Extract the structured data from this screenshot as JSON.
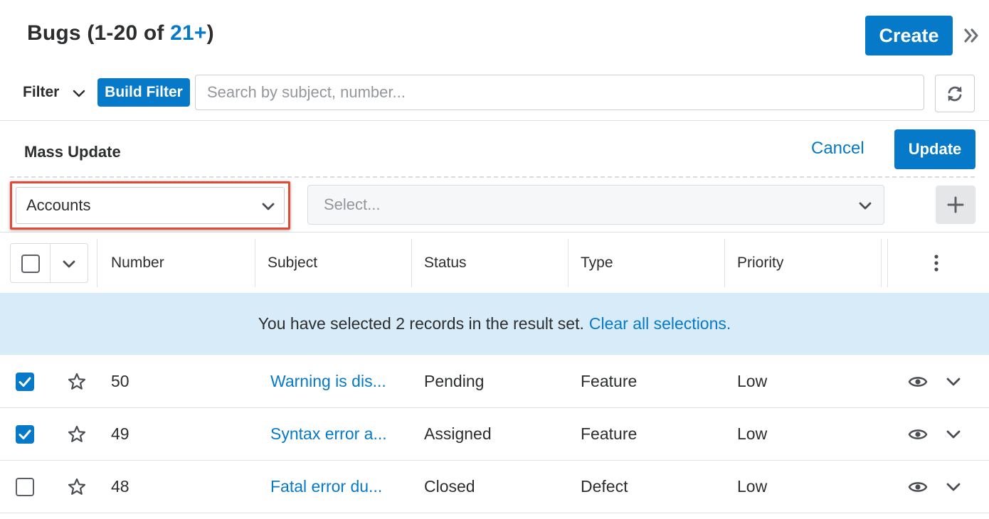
{
  "header": {
    "title_prefix": "Bugs (1-20 of ",
    "title_count": "21+",
    "title_suffix": ")",
    "create_label": "Create",
    "collapse_icon": "double-chevron-right-icon"
  },
  "filter": {
    "label": "Filter",
    "build_filter_label": "Build Filter",
    "search_placeholder": "Search by subject, number...",
    "refresh_icon": "refresh-icon"
  },
  "mass_update": {
    "title": "Mass Update",
    "cancel_label": "Cancel",
    "update_label": "Update",
    "field_select_value": "Accounts",
    "value_select_placeholder": "Select...",
    "add_icon": "plus-icon"
  },
  "table": {
    "columns": [
      "Number",
      "Subject",
      "Status",
      "Type",
      "Priority"
    ],
    "banner_text": "You have selected 2 records in the result set.",
    "banner_link": "Clear all selections.",
    "rows": [
      {
        "checked": true,
        "number": "50",
        "subject": "Warning is dis...",
        "status": "Pending",
        "type": "Feature",
        "priority": "Low"
      },
      {
        "checked": true,
        "number": "49",
        "subject": "Syntax error a...",
        "status": "Assigned",
        "type": "Feature",
        "priority": "Low"
      },
      {
        "checked": false,
        "number": "48",
        "subject": "Fatal error du...",
        "status": "Closed",
        "type": "Defect",
        "priority": "Low"
      }
    ]
  },
  "colors": {
    "accent": "#0679c8",
    "banner_bg": "#d7ebf9",
    "highlight_border": "#e24a33"
  }
}
